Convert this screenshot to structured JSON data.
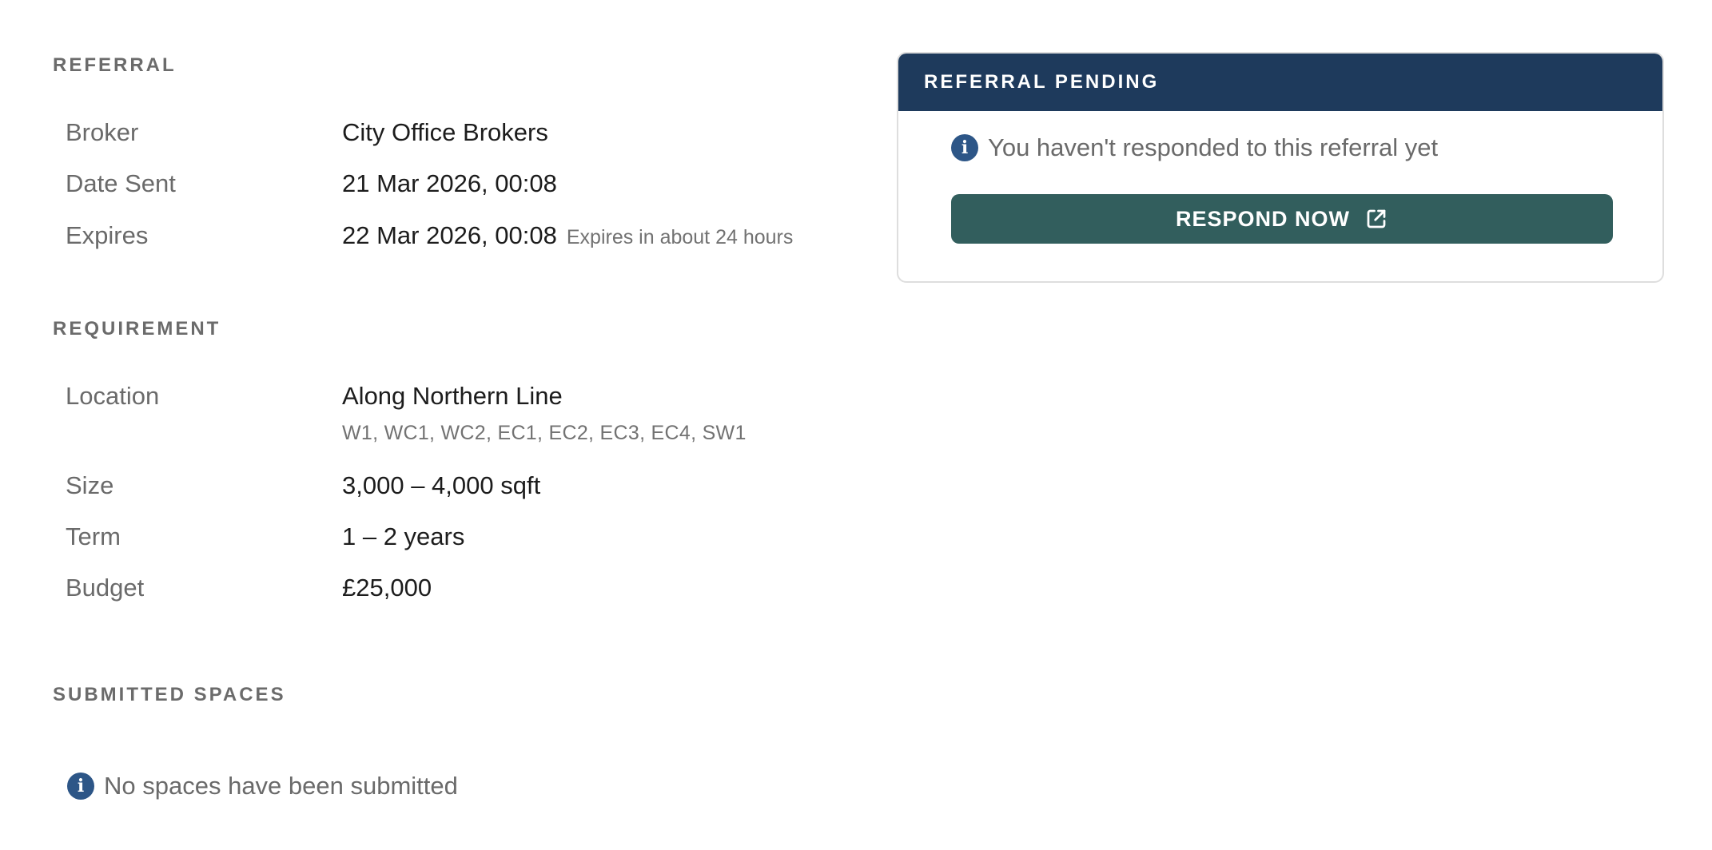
{
  "referral": {
    "section_title": "REFERRAL",
    "rows": [
      {
        "label": "Broker",
        "value": "City Office Brokers"
      },
      {
        "label": "Date Sent",
        "value": "21 Mar 2026, 00:08"
      },
      {
        "label": "Expires",
        "value": "22 Mar 2026, 00:08",
        "note": "Expires in about 24 hours"
      }
    ]
  },
  "requirement": {
    "section_title": "REQUIREMENT",
    "rows": [
      {
        "label": "Location",
        "value": "Along Northern Line",
        "sub": "W1, WC1, WC2, EC1, EC2, EC3, EC4, SW1"
      },
      {
        "label": "Size",
        "value": "3,000 – 4,000 sqft"
      },
      {
        "label": "Term",
        "value": "1 – 2 years"
      },
      {
        "label": "Budget",
        "value": "£25,000"
      }
    ]
  },
  "submitted_spaces": {
    "section_title": "SUBMITTED SPACES",
    "empty_message": "No spaces have been submitted"
  },
  "status_card": {
    "header": "REFERRAL PENDING",
    "notice": "You haven't responded to this referral yet",
    "button_label": "RESPOND NOW",
    "button_icon": "external-link-icon",
    "colors": {
      "header_bg": "#1e3a5c",
      "button_bg": "#325e5d",
      "info_icon": "#2d5687"
    }
  }
}
